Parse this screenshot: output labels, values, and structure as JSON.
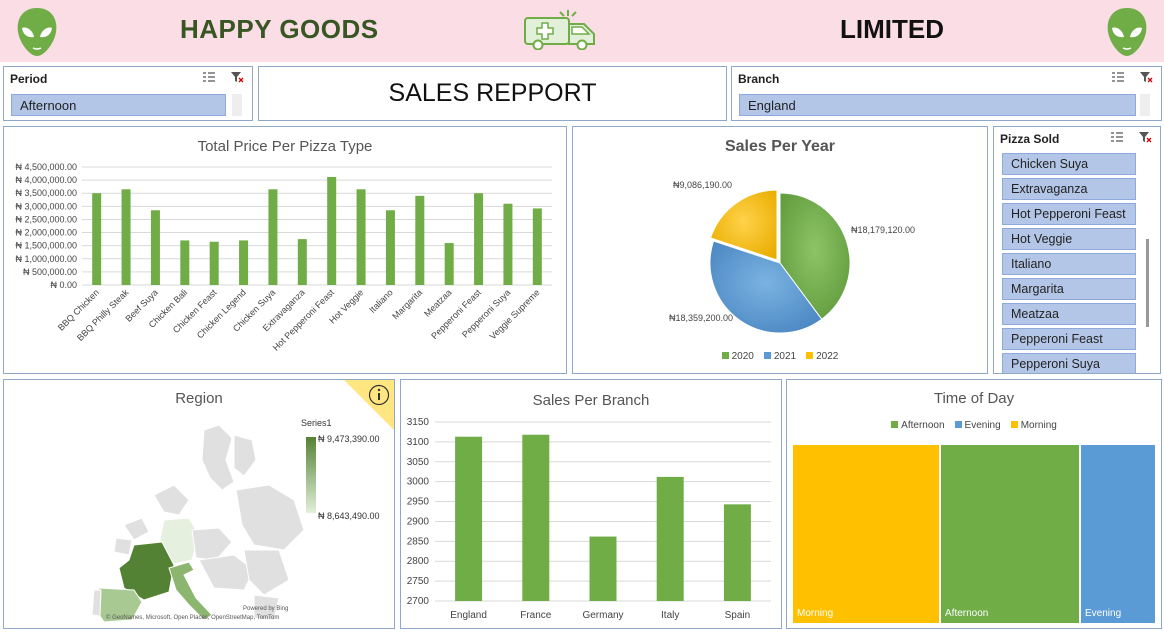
{
  "header": {
    "brand_left": "HAPPY GOODS",
    "brand_right": "LIMITED",
    "alien_icon": "alien-icon",
    "center_icon": "ambulance-icon"
  },
  "period_slicer": {
    "title": "Period",
    "selected": "Afternoon"
  },
  "report": {
    "title": "SALES REPPORT"
  },
  "branch_slicer": {
    "title": "Branch",
    "selected": "England"
  },
  "pizza_slicer": {
    "title": "Pizza Sold",
    "items": [
      "Chicken Suya",
      "Extravaganza",
      "Hot Pepperoni Feast",
      "Hot Veggie",
      "Italiano",
      "Margarita",
      "Meatzaa",
      "Pepperoni Feast",
      "Pepperoni Suya"
    ]
  },
  "colors": {
    "green": "#70ad47",
    "blue": "#5b9bd5",
    "gold": "#ffc000",
    "header_bg": "#fbdde6",
    "slicer_item": "#b4c6e7"
  },
  "charts": {
    "pizza_price": {
      "title": "Total Price Per Pizza Type",
      "y_ticks": [
        "₦ 4,500,000.00",
        "₦ 4,000,000.00",
        "₦ 3,500,000.00",
        "₦ 3,000,000.00",
        "₦ 2,500,000.00",
        "₦ 2,000,000.00",
        "₦ 1,500,000.00",
        "₦ 1,000,000.00",
        "₦ 500,000.00",
        "₦ 0.00"
      ]
    },
    "year": {
      "title": "Sales Per Year",
      "labels": [
        "₦18,179,120.00",
        "₦18,359,200.00",
        "₦9,086,190.00"
      ],
      "legend": [
        "2020",
        "2021",
        "2022"
      ]
    },
    "region": {
      "title": "Region",
      "series_label": "Series1",
      "max_label": "₦ 9,473,390.00",
      "min_label": "₦ 8,643,490.00",
      "powered": "Powered by Bing",
      "credits": "© GeoNames, Microsoft, Open Places, OpenStreetMap, TomTom"
    },
    "branch": {
      "title": "Sales Per Branch"
    },
    "time_of_day": {
      "title": "Time of Day",
      "legend": [
        "Afternoon",
        "Evening",
        "Morning"
      ],
      "boxes": [
        "Morning",
        "Afternoon",
        "Evening"
      ]
    }
  },
  "chart_data": [
    {
      "type": "bar",
      "title": "Total Price Per Pizza Type",
      "categories": [
        "BBQ Chicken",
        "BBQ Philly Steak",
        "Beef Suya",
        "Chicken Bali",
        "Chicken Feast",
        "Chicken Legend",
        "Chicken Suya",
        "Extravaganza",
        "Hot Pepperoni Feast",
        "Hot Veggie",
        "Italiano",
        "Margarita",
        "Meatzaa",
        "Pepperoni Feast",
        "Pepperoni Suya",
        "Veggie Supreme"
      ],
      "values": [
        3500000,
        3650000,
        2850000,
        1700000,
        1650000,
        1700000,
        3650000,
        1750000,
        4120000,
        3650000,
        2850000,
        3400000,
        1600000,
        3500000,
        3100000,
        2920000
      ],
      "ylim": [
        0,
        4500000
      ],
      "grid": true
    },
    {
      "type": "pie",
      "title": "Sales Per Year",
      "categories": [
        "2020",
        "2021",
        "2022"
      ],
      "values": [
        18179120,
        18359200,
        9086190
      ],
      "legend": "bottom"
    },
    {
      "type": "bar",
      "title": "Sales Per Branch",
      "categories": [
        "England",
        "France",
        "Germany",
        "Italy",
        "Spain"
      ],
      "values": [
        3113,
        3118,
        2862,
        3012,
        2943
      ],
      "ylim": [
        2700,
        3150
      ],
      "y_ticks": [
        3150,
        3100,
        3050,
        3000,
        2950,
        2900,
        2850,
        2800,
        2750,
        2700
      ]
    },
    {
      "type": "treemap",
      "title": "Time of Day",
      "categories": [
        "Morning",
        "Afternoon",
        "Evening"
      ],
      "values": [
        3,
        3,
        1.8
      ],
      "legend": "top"
    }
  ]
}
